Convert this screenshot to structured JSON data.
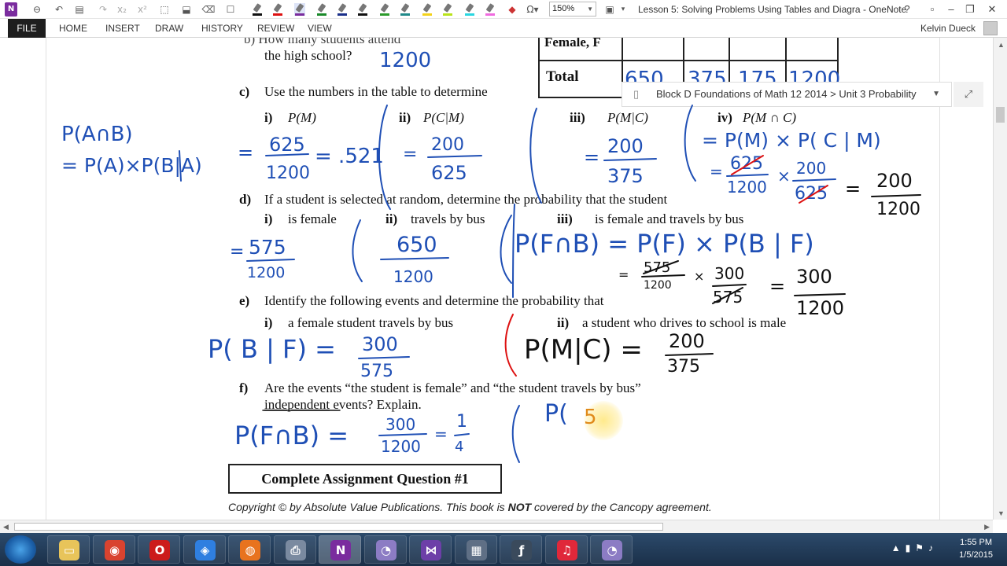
{
  "window": {
    "title": "Lesson 5: Solving Problems Using Tables and Diagra - OneNote",
    "zoom": "150%",
    "controls": [
      "?",
      "–",
      "❐",
      "✕"
    ]
  },
  "ribbon": {
    "file": "FILE",
    "tabs": [
      "HOME",
      "INSERT",
      "DRAW",
      "HISTORY",
      "REVIEW",
      "VIEW"
    ],
    "user": "Kelvin Dueck"
  },
  "notebook": {
    "path": "Block D Foundations of Math 12 2014 > Unit 3 Probability"
  },
  "table": {
    "top_label": "Female, F",
    "total_label": "Total",
    "totals": [
      "650",
      "375",
      "175",
      "1200"
    ]
  },
  "worksheet": {
    "b_cut": "b)  How many students attend",
    "b_text": "the high school?",
    "c_label": "c)",
    "c_text": "Use the numbers in the table to determine",
    "c_parts": [
      {
        "num": "i)",
        "expr": "P(M)"
      },
      {
        "num": "ii)",
        "expr": "P(C|M)"
      },
      {
        "num": "iii)",
        "expr": "P(M|C)"
      },
      {
        "num": "iv)",
        "expr": "P(M ∩ C)"
      }
    ],
    "d_label": "d)",
    "d_text": "If a student is selected at random, determine the probability that the student",
    "d_parts": [
      {
        "num": "i)",
        "text": "is female"
      },
      {
        "num": "ii)",
        "text": "travels by bus"
      },
      {
        "num": "iii)",
        "text": "is female and travels by bus"
      }
    ],
    "e_label": "e)",
    "e_text": "Identify the following events and determine the probability that",
    "e_parts": [
      {
        "num": "i)",
        "text": "a female student travels by bus"
      },
      {
        "num": "ii)",
        "text": "a student who drives to school is male"
      }
    ],
    "f_label": "f)",
    "f_text1": "Are the events “the student is female” and “the student travels by bus”",
    "f_text2a": "independent",
    "f_text2b": " events?  Explain.",
    "assignment": "Complete Assignment Question #1",
    "copyright_a": "Copyright © by Absolute Value Publications.  This book is ",
    "copyright_b": "NOT",
    "copyright_c": " covered by the Cancopy agreement."
  },
  "ink": {
    "ans_b": "1200",
    "rule_1": "P(A∩B)",
    "rule_2": "= P(A)×P(B|A)",
    "c1_eq": "=",
    "c1_num": "625",
    "c1_den": "1200",
    "c1_dec": "= .521",
    "c2_eq": "=",
    "c2_num": "200",
    "c2_den": "625",
    "c3_eq": "=",
    "c3_num": "200",
    "c3_den": "375",
    "c4_line1": "= P(M) × P( C | M)",
    "c4_eq": "=",
    "c4_n1": "625",
    "c4_d1": "1200",
    "c4_times": "×",
    "c4_n2": "200",
    "c4_d2": "625",
    "c4_req": "=",
    "c4_rn": "200",
    "c4_rd": "1200",
    "d1_eq": "=",
    "d1_num": "575",
    "d1_den": "1200",
    "d2_num": "650",
    "d2_den": "1200",
    "d3_line1": "P(F∩B) = P(F) × P(B | F)",
    "d3_eq": "=",
    "d3_n1": "575",
    "d3_d1": "1200",
    "d3_times": "×",
    "d3_n2": "300",
    "d3_d2": "575",
    "d3_req": "=",
    "d3_rn": "300",
    "d3_rd": "1200",
    "e1_lhs": "P( B | F)  =",
    "e1_num": "300",
    "e1_den": "575",
    "e2_lhs": "P(M|C)  =",
    "e2_num": "200",
    "e2_den": "375",
    "f_lhs": "P(F∩B)  =",
    "f_n1": "300",
    "f_d1": "1200",
    "f_eq2": "=",
    "f_n2": "1",
    "f_d2": "4",
    "f_partial_a": "P(",
    "f_partial_b": "5"
  },
  "taskbar": {
    "apps": [
      {
        "name": "Explorer",
        "icon": "folder-icon",
        "color": "#e8c45a"
      },
      {
        "name": "Chrome",
        "icon": "chrome-icon",
        "color": "#d9432f"
      },
      {
        "name": "Opera",
        "icon": "opera-icon",
        "color": "#cc1b1b"
      },
      {
        "name": "Dropbox",
        "icon": "dropbox-icon",
        "color": "#2f7fe0"
      },
      {
        "name": "Firefox",
        "icon": "firefox-icon",
        "color": "#e8731e"
      },
      {
        "name": "Devices",
        "icon": "printer-icon",
        "color": "#7a8aa0"
      },
      {
        "name": "OneNote",
        "icon": "onenote-icon",
        "color": "#7a2c9e"
      },
      {
        "name": "Speedometer",
        "icon": "gauge-icon",
        "color": "#8c7cc4"
      },
      {
        "name": "Visual Studio",
        "icon": "vs-icon",
        "color": "#6d3fa8"
      },
      {
        "name": "Calculator",
        "icon": "calculator-icon",
        "color": "#5f6f85"
      },
      {
        "name": "Flash",
        "icon": "flash-icon",
        "color": "#3a4a5c"
      },
      {
        "name": "Music",
        "icon": "music-icon",
        "color": "#e0283a"
      },
      {
        "name": "Recorder",
        "icon": "recorder-icon",
        "color": "#8c7cc4"
      }
    ],
    "time": "1:55 PM",
    "date": "1/5/2015"
  }
}
